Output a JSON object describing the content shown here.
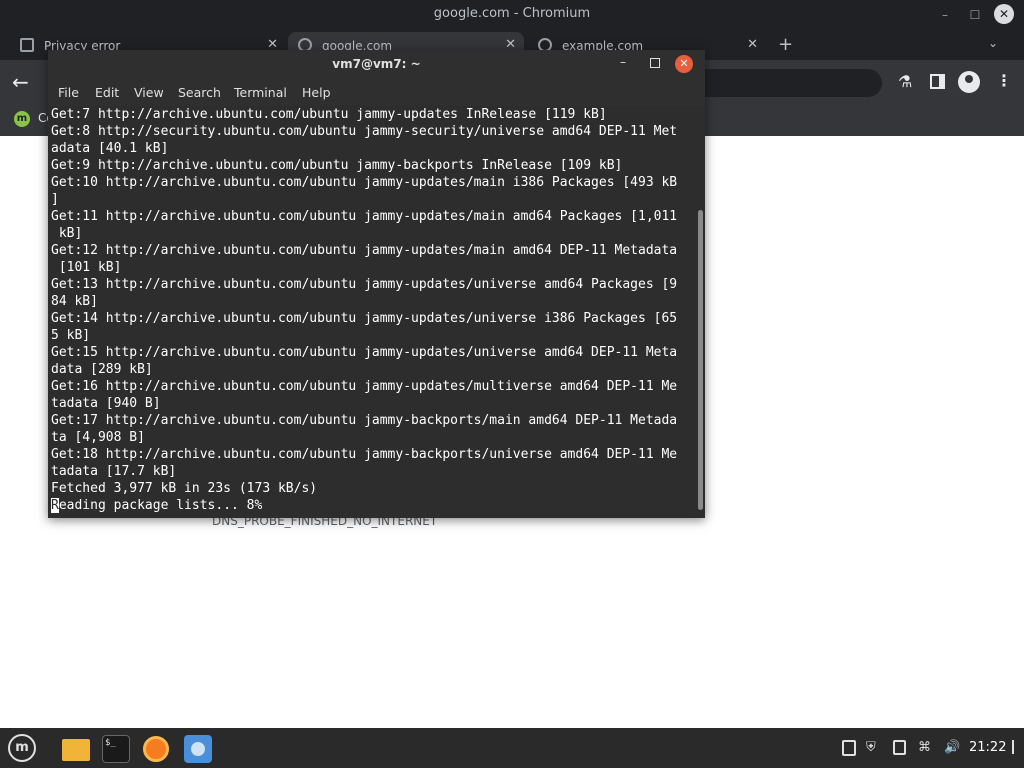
{
  "chromium": {
    "window_title": "google.com - Chromium",
    "tabs": [
      {
        "title": "Privacy error"
      },
      {
        "title": "google.com"
      },
      {
        "title": "example.com"
      }
    ],
    "bookmark_partial": "Co",
    "error_code": "DNS_PROBE_FINISHED_NO_INTERNET"
  },
  "terminal": {
    "title": "vm7@vm7: ~",
    "menu": {
      "file": "File",
      "edit": "Edit",
      "view": "View",
      "search": "Search",
      "terminal": "Terminal",
      "help": "Help"
    },
    "output": "Get:7 http://archive.ubuntu.com/ubuntu jammy-updates InRelease [119 kB]\nGet:8 http://security.ubuntu.com/ubuntu jammy-security/universe amd64 DEP-11 Met\nadata [40.1 kB]\nGet:9 http://archive.ubuntu.com/ubuntu jammy-backports InRelease [109 kB]\nGet:10 http://archive.ubuntu.com/ubuntu jammy-updates/main i386 Packages [493 kB\n]\nGet:11 http://archive.ubuntu.com/ubuntu jammy-updates/main amd64 Packages [1,011\n kB]\nGet:12 http://archive.ubuntu.com/ubuntu jammy-updates/main amd64 DEP-11 Metadata\n [101 kB]\nGet:13 http://archive.ubuntu.com/ubuntu jammy-updates/universe amd64 Packages [9\n84 kB]\nGet:14 http://archive.ubuntu.com/ubuntu jammy-updates/universe i386 Packages [65\n5 kB]\nGet:15 http://archive.ubuntu.com/ubuntu jammy-updates/universe amd64 DEP-11 Meta\ndata [289 kB]\nGet:16 http://archive.ubuntu.com/ubuntu jammy-updates/multiverse amd64 DEP-11 Me\ntadata [940 B]\nGet:17 http://archive.ubuntu.com/ubuntu jammy-backports/main amd64 DEP-11 Metada\nta [4,908 B]\nGet:18 http://archive.ubuntu.com/ubuntu jammy-backports/universe amd64 DEP-11 Me\ntadata [17.7 kB]\nFetched 3,977 kB in 23s (173 kB/s)",
    "cursor_char": "R",
    "last_line_rest": "eading package lists... 8%"
  },
  "taskbar": {
    "clock": "21:22",
    "apps": [
      "files-icon",
      "terminal-icon",
      "firefox-icon",
      "chromium-icon"
    ],
    "terminal_glyph": "$_"
  },
  "icons": {
    "back": "←",
    "close": "✕",
    "new_tab": "+",
    "chevron": "⌄",
    "minimize": "–",
    "maximize": "☐",
    "kebab": "⋮",
    "extension": "⚗",
    "shield": "⛨",
    "network": "⌘",
    "volume": "🔊",
    "mint": "m"
  },
  "colors": {
    "terminal_close": "#e95f3e",
    "terminal_bg": "#2d2d2d",
    "chrome_dark": "#202124"
  }
}
